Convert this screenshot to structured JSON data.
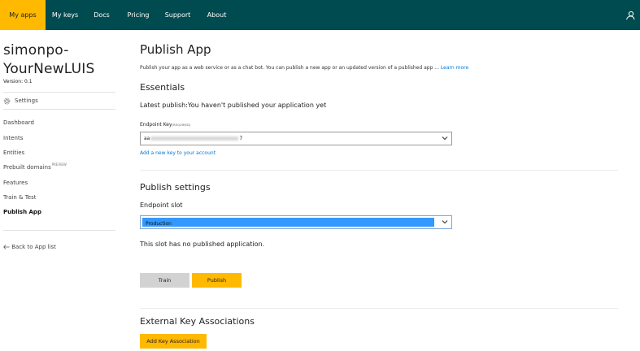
{
  "topnav": {
    "items": [
      {
        "label": "My apps",
        "active": true
      },
      {
        "label": "My keys",
        "active": false
      },
      {
        "label": "Docs",
        "active": false
      },
      {
        "label": "Pricing",
        "active": false
      },
      {
        "label": "Support",
        "active": false
      },
      {
        "label": "About",
        "active": false
      }
    ],
    "user_icon": "user-icon"
  },
  "sidebar": {
    "app_name_line1": "simonpo-",
    "app_name_line2": "YourNewLUIS",
    "version": "Version:  0.1",
    "settings_label": "Settings",
    "settings_icon": "gear-icon",
    "items": [
      {
        "label": "Dashboard"
      },
      {
        "label": "Intents"
      },
      {
        "label": "Entities"
      },
      {
        "label": "Prebuilt domains",
        "tag": "PREVIEW"
      },
      {
        "label": "Features"
      },
      {
        "label": "Train & Test"
      },
      {
        "label": "Publish App",
        "current": true
      }
    ],
    "back_label": "Back to App list",
    "back_icon": "arrow-left-icon"
  },
  "main": {
    "title": "Publish App",
    "intro": "Publish your app as a web service or as a chat bot. You can publish a new app or an updated version of a published app ... ",
    "learn_more": "Learn more",
    "essentials": {
      "heading": "Essentials",
      "latest_publish": "Latest publish:You haven't published your application yet",
      "endpoint_key_label": "Endpoint Key",
      "endpoint_key_required": "(REQUIRED)",
      "endpoint_key_prefix": "aa",
      "endpoint_key_suffix": "7",
      "add_key_link": "Add a new key to your account"
    },
    "publish_settings": {
      "heading": "Publish settings",
      "slot_label": "Endpoint slot",
      "slot_value": "Production",
      "slot_status": "This slot has no published application.",
      "train_button": "Train",
      "publish_button": "Publish"
    },
    "external": {
      "heading": "External Key Associations",
      "add_button": "Add Key Association"
    }
  },
  "colors": {
    "topbar": "#004b50",
    "accent": "#ffb900",
    "link": "#0078d7",
    "selection": "#3399ff"
  }
}
